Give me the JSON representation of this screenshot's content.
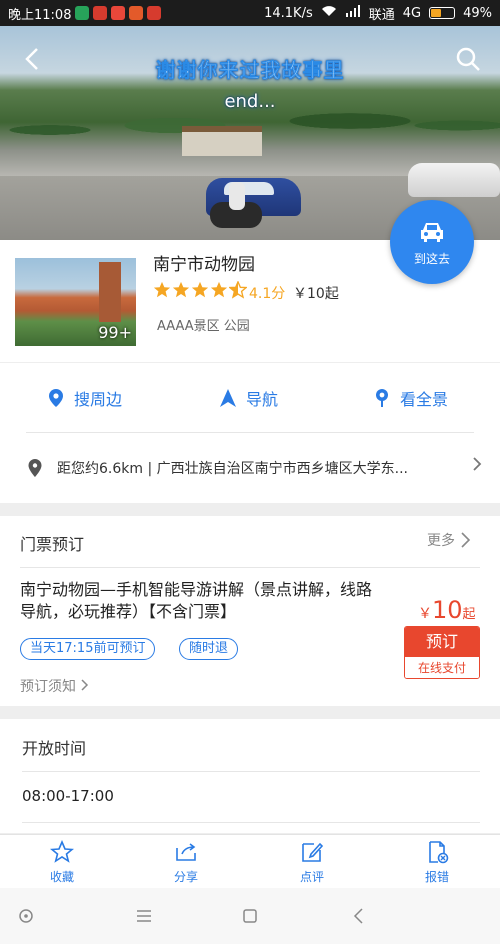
{
  "status_bar": {
    "time": "晚上11:08",
    "network_speed": "14.1K/s",
    "carrier": "联通",
    "network_type": "4G",
    "battery": "49%",
    "battery_level": 0.49
  },
  "hero": {
    "line1": "谢谢你来过我故事里",
    "line2": "end..."
  },
  "go_button": {
    "label": "到这去"
  },
  "place": {
    "name": "南宁市动物园",
    "photo_count": "99+",
    "rating_stars": 4.1,
    "rating_text": "4.1分",
    "price_from": "￥10起",
    "tags": "AAAA景区 公园"
  },
  "actions": [
    {
      "label": "搜周边",
      "icon": "location-pin-icon"
    },
    {
      "label": "导航",
      "icon": "navigation-arrow-icon"
    },
    {
      "label": "看全景",
      "icon": "panorama-pin-icon"
    }
  ],
  "distance": {
    "text": "距您约6.6km | 广西壮族自治区南宁市西乡塘区大学东..."
  },
  "tickets": {
    "section_title": "门票预订",
    "more_label": "更多",
    "item": {
      "name": "南宁动物园—手机智能导游讲解（景点讲解，线路导航，必玩推荐）【不含门票】",
      "currency": "￥",
      "price": "10",
      "price_suffix": "起",
      "tags": [
        "当天17:15前可预订",
        "随时退"
      ],
      "book_label": "预订",
      "pay_label": "在线支付"
    },
    "notice": "预订须知"
  },
  "hours": {
    "section_title": "开放时间",
    "value": "08:00-17:00"
  },
  "tabbar": [
    {
      "label": "收藏",
      "icon": "star-icon"
    },
    {
      "label": "分享",
      "icon": "share-icon"
    },
    {
      "label": "点评",
      "icon": "edit-icon"
    },
    {
      "label": "报错",
      "icon": "report-icon"
    }
  ],
  "colors": {
    "accent": "#2a7be4",
    "price_red": "#e8472e",
    "star_orange": "#f5a623"
  }
}
